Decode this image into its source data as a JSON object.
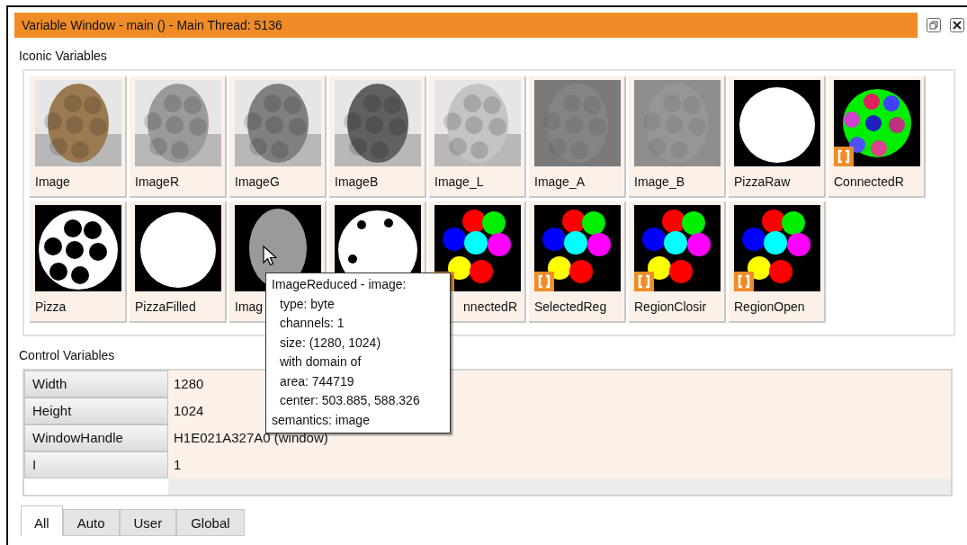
{
  "window": {
    "title": "Variable Window - main () - Main Thread: 5136"
  },
  "iconic_variables": {
    "heading": "Iconic Variables",
    "items": [
      {
        "label": "Image",
        "kind": "photo",
        "color": "#9a7a50",
        "region": false
      },
      {
        "label": "ImageR",
        "kind": "photo",
        "color": "#9a9a9a",
        "region": false
      },
      {
        "label": "ImageG",
        "kind": "photo",
        "color": "#808080",
        "region": false
      },
      {
        "label": "ImageB",
        "kind": "photo",
        "color": "#606060",
        "region": false
      },
      {
        "label": "Image_L",
        "kind": "photo",
        "color": "#c4c4c4",
        "region": false
      },
      {
        "label": "Image_A",
        "kind": "flat",
        "color": "#7a7a7a",
        "region": false
      },
      {
        "label": "Image_B",
        "kind": "flat",
        "color": "#8e8e8e",
        "region": false
      },
      {
        "label": "PizzaRaw",
        "kind": "disk",
        "region": false
      },
      {
        "label": "ConnectedR",
        "kind": "noisy",
        "region": true
      },
      {
        "label": "Pizza",
        "kind": "holes",
        "region": false
      },
      {
        "label": "PizzaFilled",
        "kind": "disk",
        "region": false
      },
      {
        "label": "Imag",
        "kind": "gray-disk",
        "region": false
      },
      {
        "kind": "blobs",
        "region": false
      },
      {
        "label": "nnectedR",
        "cut_at_start": true,
        "kind": "regions",
        "region": true
      },
      {
        "label": "SelectedReg",
        "kind": "regions",
        "region": true
      },
      {
        "label": "RegionClosir",
        "kind": "regions",
        "region": true
      },
      {
        "label": "RegionOpen",
        "kind": "regions",
        "region": true
      }
    ]
  },
  "tooltip": {
    "title": "ImageReduced - image:",
    "details": [
      "type: byte",
      "channels: 1",
      "size: (1280, 1024)",
      "with domain of",
      "area: 744719",
      "center: 503.885, 588.326"
    ],
    "footer": "semantics: image"
  },
  "control_variables": {
    "heading": "Control Variables",
    "rows": [
      {
        "name": "Width",
        "value": "1280"
      },
      {
        "name": "Height",
        "value": "1024"
      },
      {
        "name": "WindowHandle",
        "value": "H1E021A327A0 (window)"
      },
      {
        "name": "I",
        "value": "1"
      }
    ]
  },
  "tabs": [
    {
      "label": "All",
      "selected": true
    },
    {
      "label": "Auto",
      "selected": false
    },
    {
      "label": "User",
      "selected": false
    },
    {
      "label": "Global",
      "selected": false
    }
  ]
}
